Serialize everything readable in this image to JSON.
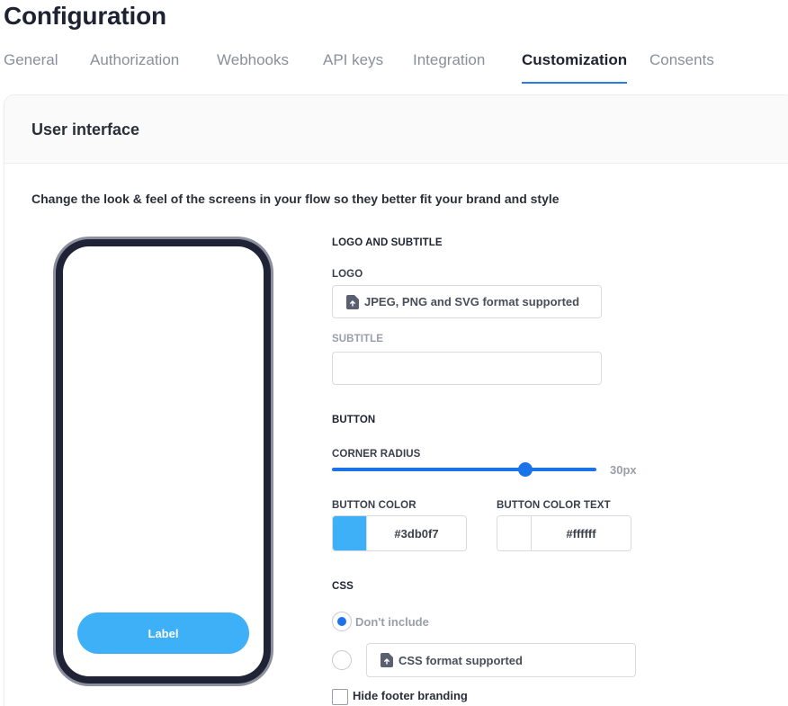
{
  "page": {
    "title": "Configuration"
  },
  "tabs": [
    {
      "label": "General"
    },
    {
      "label": "Authorization"
    },
    {
      "label": "Webhooks"
    },
    {
      "label": "API keys"
    },
    {
      "label": "Integration"
    },
    {
      "label": "Customization",
      "active": true
    },
    {
      "label": "Consents"
    }
  ],
  "card": {
    "title": "User interface",
    "description": "Change the look & feel of the screens in your flow so they better fit your brand and style"
  },
  "preview": {
    "button_label": "Label",
    "button_color": "#3db0f7"
  },
  "logo_subtitle": {
    "section_label": "LOGO AND SUBTITLE",
    "logo_label": "LOGO",
    "logo_upload_text": "JPEG, PNG and SVG format supported",
    "subtitle_label": "SUBTITLE",
    "subtitle_value": ""
  },
  "button": {
    "section_label": "BUTTON",
    "corner_radius_label": "CORNER RADIUS",
    "corner_radius_value": "30px",
    "corner_radius_fraction": 0.73,
    "color_label": "BUTTON COLOR",
    "color_value": "#3db0f7",
    "color_text_label": "BUTTON COLOR TEXT",
    "color_text_value": "#ffffff"
  },
  "css": {
    "section_label": "CSS",
    "option_dont_include": "Don't include",
    "upload_text": "CSS format supported",
    "selected": "dont_include"
  },
  "footer": {
    "hide_branding_label": "Hide footer branding",
    "hide_branding_checked": false
  },
  "colors": {
    "accent": "#1a73e8",
    "tab_underline": "#2a7be4"
  }
}
